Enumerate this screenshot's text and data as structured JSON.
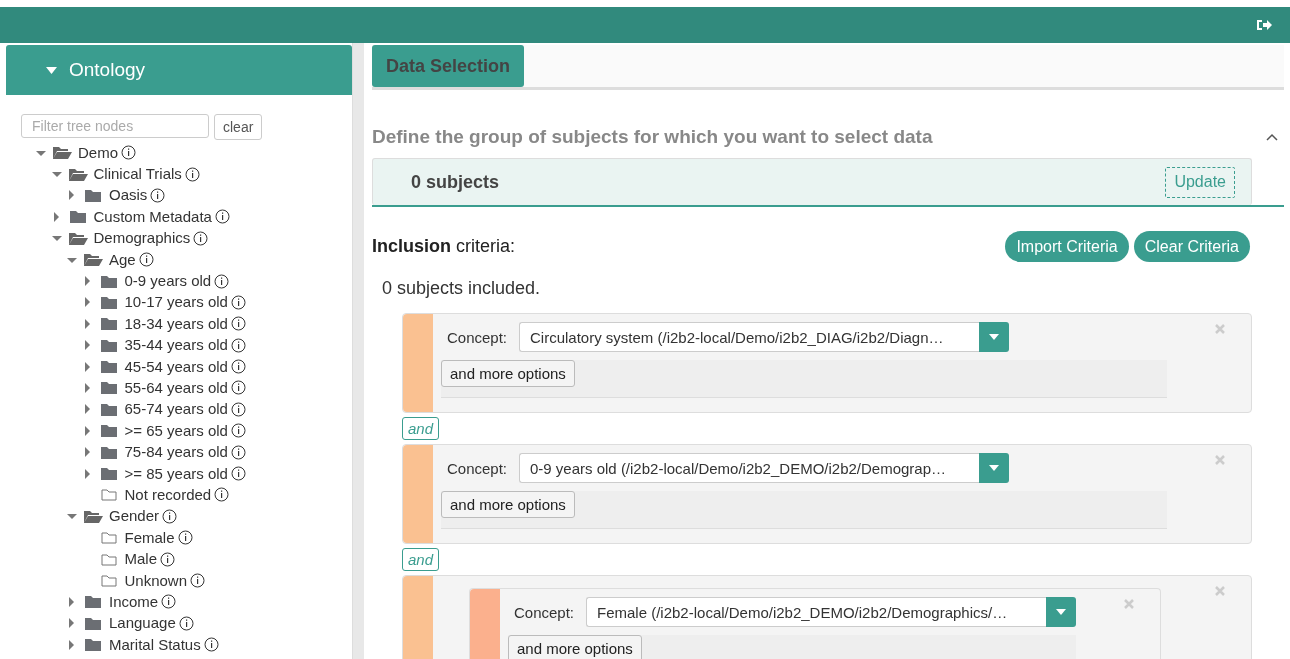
{
  "sidebar": {
    "title": "Ontology",
    "expanded": true,
    "filter": {
      "placeholder": "Filter tree nodes"
    },
    "clear_button": "clear",
    "tree": [
      {
        "label": "Demo",
        "kind": "folder",
        "expanded": true,
        "children": [
          {
            "label": "Clinical Trials",
            "kind": "folder",
            "expanded": true,
            "children": [
              {
                "label": "Oasis",
                "kind": "folder",
                "expanded": false
              }
            ]
          },
          {
            "label": "Custom Metadata",
            "kind": "folder",
            "expanded": false
          },
          {
            "label": "Demographics",
            "kind": "folder",
            "expanded": true,
            "children": [
              {
                "label": "Age",
                "kind": "folder",
                "expanded": true,
                "children": [
                  {
                    "label": "0-9 years old",
                    "kind": "folder",
                    "expanded": false
                  },
                  {
                    "label": "10-17 years old",
                    "kind": "folder",
                    "expanded": false
                  },
                  {
                    "label": "18-34 years old",
                    "kind": "folder",
                    "expanded": false
                  },
                  {
                    "label": "35-44 years old",
                    "kind": "folder",
                    "expanded": false
                  },
                  {
                    "label": "45-54 years old",
                    "kind": "folder",
                    "expanded": false
                  },
                  {
                    "label": "55-64 years old",
                    "kind": "folder",
                    "expanded": false
                  },
                  {
                    "label": "65-74 years old",
                    "kind": "folder",
                    "expanded": false
                  },
                  {
                    "label": ">= 65 years old",
                    "kind": "folder",
                    "expanded": false
                  },
                  {
                    "label": "75-84 years old",
                    "kind": "folder",
                    "expanded": false
                  },
                  {
                    "label": ">= 85 years old",
                    "kind": "folder",
                    "expanded": false
                  },
                  {
                    "label": "Not recorded",
                    "kind": "leaf"
                  }
                ]
              },
              {
                "label": "Gender",
                "kind": "folder",
                "expanded": true,
                "children": [
                  {
                    "label": "Female",
                    "kind": "leaf"
                  },
                  {
                    "label": "Male",
                    "kind": "leaf"
                  },
                  {
                    "label": "Unknown",
                    "kind": "leaf"
                  }
                ]
              },
              {
                "label": "Income",
                "kind": "folder",
                "expanded": false
              },
              {
                "label": "Language",
                "kind": "folder",
                "expanded": false
              },
              {
                "label": "Marital Status",
                "kind": "folder",
                "expanded": false
              }
            ]
          }
        ]
      }
    ]
  },
  "tabs": [
    {
      "label": "Data Selection",
      "selected": true
    }
  ],
  "section": {
    "title": "Define the group of subjects for which you want to select data",
    "expanded": true,
    "count": "0 subjects",
    "update_button": "Update",
    "inclusion_label": "**Inclusion** criteria:",
    "buttons": [
      "Import Criteria",
      "Clear Criteria"
    ],
    "included": "0 subjects included.",
    "criteria": [
      {
        "kind": "concept",
        "label": "Concept:",
        "value": "Circulatory system (/i2b2-local/Demo/i2b2_DIAG/i2b2/Diagn…",
        "options": "and more options"
      },
      {
        "kind": "operator",
        "label": "and"
      },
      {
        "kind": "concept",
        "label": "Concept:",
        "value": "0-9 years old (/i2b2-local/Demo/i2b2_DEMO/i2b2/Demograp…",
        "options": "and more options"
      },
      {
        "kind": "operator",
        "label": "and"
      },
      {
        "kind": "group",
        "children": [
          {
            "kind": "concept",
            "label": "Concept:",
            "value": "Female (/i2b2-local/Demo/i2b2_DEMO/i2b2/Demographics/…",
            "options": "and more options"
          }
        ]
      }
    ]
  }
}
